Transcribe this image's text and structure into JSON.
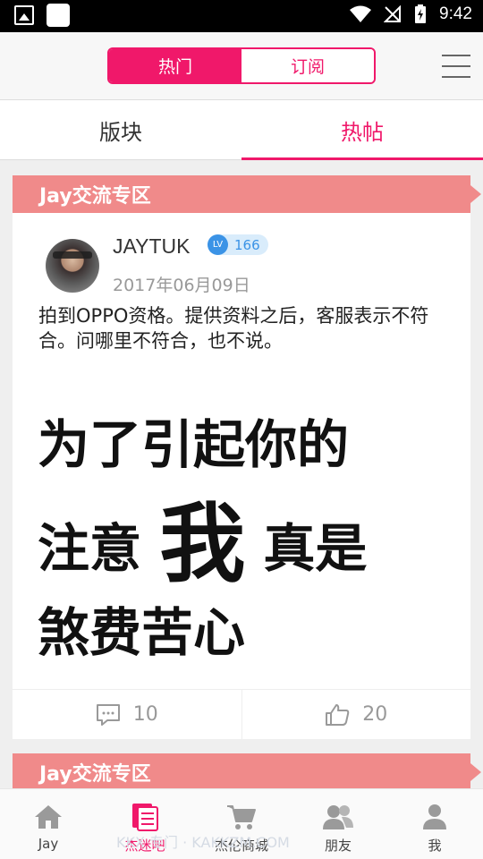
{
  "status_bar": {
    "time": "9:42"
  },
  "header": {
    "segments": [
      {
        "label": "热门",
        "active": true
      },
      {
        "label": "订阅",
        "active": false
      }
    ],
    "menu_icon": "hamburger-menu-icon"
  },
  "sub_tabs": [
    {
      "label": "版块",
      "active": false
    },
    {
      "label": "热帖",
      "active": true
    }
  ],
  "feed": {
    "section_title": "Jay交流专区",
    "post": {
      "author": "JAYTUK",
      "level_badge": "LV",
      "level": "166",
      "date": "2017年06月09日",
      "text": "拍到OPPO资格。提供资料之后，客服表示不符合。问哪里不符合，也不说。",
      "image_text": {
        "line1": "为了引起你的",
        "line2_pre": "注意",
        "line2_big": "我",
        "line2_post": "真是",
        "line3": "煞费苦心"
      },
      "comment_count": "10",
      "like_count": "20"
    },
    "next_section_title": "Jay交流专区"
  },
  "bottom_nav": [
    {
      "label": "Jay",
      "icon": "home-icon",
      "active": false
    },
    {
      "label": "杰迷吧",
      "icon": "forum-icon",
      "active": true
    },
    {
      "label": "杰伦商城",
      "icon": "cart-icon",
      "active": false
    },
    {
      "label": "朋友",
      "icon": "friends-icon",
      "active": false
    },
    {
      "label": "我",
      "icon": "person-icon",
      "active": false
    }
  ],
  "watermark": "KKX 专门 · KAKKZM.COM",
  "colors": {
    "accent": "#f0186a",
    "section": "#f08a8a",
    "level": "#3b93e6"
  }
}
